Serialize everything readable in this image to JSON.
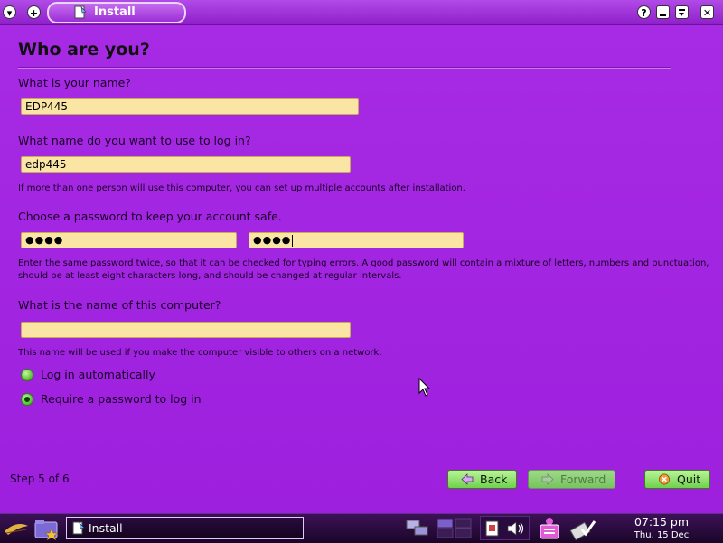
{
  "window": {
    "title": "Install",
    "menu_icon": "chevron-down-icon",
    "add_icon": "plus-icon",
    "help_icon": "help-icon",
    "minimize_icon": "minimize-icon",
    "maximize_icon": "maximize-icon",
    "close_icon": "close-icon"
  },
  "page": {
    "heading": "Who are you?",
    "name": {
      "label": "What is your name?",
      "value": "EDP445"
    },
    "login": {
      "label": "What name do you want to use to log in?",
      "value": "edp445",
      "note": "If more than one person will use this computer, you can set up multiple accounts after installation."
    },
    "password": {
      "label": "Choose a password to keep your account safe.",
      "value": "●●●●",
      "confirm_value": "●●●●",
      "note_line1": "Enter the same password twice, so that it can be checked for typing errors. A good password will contain a mixture of letters, numbers and punctuation,",
      "note_line2": "should be at least eight characters long, and should be changed at regular intervals."
    },
    "computer": {
      "label": "What is the name of this computer?",
      "value": "",
      "note": "This name will be used if you make the computer visible to others on a network."
    },
    "login_options": [
      {
        "label": "Log in automatically",
        "selected": false
      },
      {
        "label": "Require a password to log in",
        "selected": true
      }
    ],
    "step": "Step 5 of 6"
  },
  "buttons": {
    "back": "Back",
    "forward": "Forward",
    "quit": "Quit"
  },
  "taskbar": {
    "task_label": "Install",
    "time": "07:15 pm",
    "date": "Thu, 15 Dec"
  },
  "colors": {
    "background": "#a125e0",
    "field": "#fbe5a5",
    "button_green": "#6fd24b",
    "taskbar": "#1a0628"
  }
}
